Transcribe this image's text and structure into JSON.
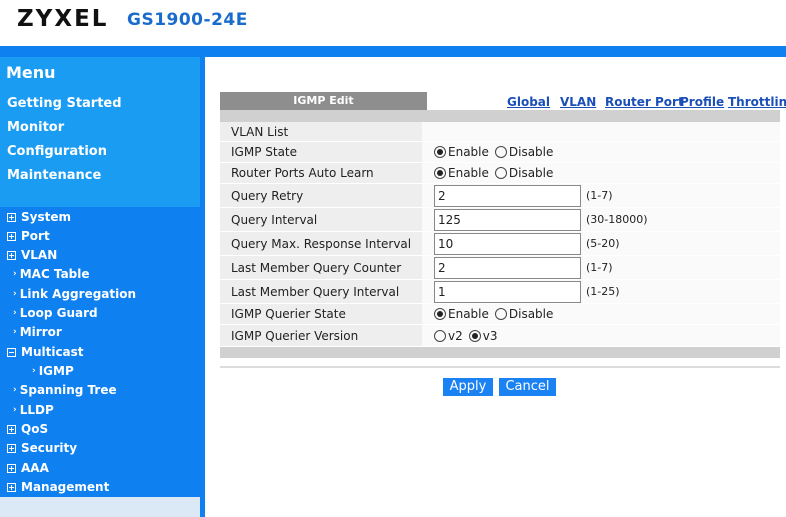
{
  "header": {
    "brand": "ZYXEL",
    "model": "GS1900-24E"
  },
  "colors": {
    "header_bar": "#0e80f0",
    "sidebar_top": "#1a9cf3",
    "sidebar_bottom": "#0e80f0",
    "link": "#1a4fb8",
    "button": "#1a82f2",
    "model_text": "#1a6ccc"
  },
  "menu": {
    "title": "Menu",
    "items": [
      {
        "label": "Getting Started"
      },
      {
        "label": "Monitor"
      },
      {
        "label": "Configuration"
      },
      {
        "label": "Maintenance"
      }
    ]
  },
  "tree": {
    "items": [
      {
        "label": "System",
        "icon": "plus-box-icon"
      },
      {
        "label": "Port",
        "icon": "plus-box-icon"
      },
      {
        "label": "VLAN",
        "icon": "plus-box-icon"
      },
      {
        "label": "MAC Table",
        "icon": "arrow-icon"
      },
      {
        "label": "Link Aggregation",
        "icon": "arrow-icon"
      },
      {
        "label": "Loop Guard",
        "icon": "arrow-icon"
      },
      {
        "label": "Mirror",
        "icon": "arrow-icon"
      },
      {
        "label": "Multicast",
        "icon": "minus-box-icon"
      },
      {
        "label": "IGMP",
        "icon": "arrow-icon"
      },
      {
        "label": "Spanning Tree",
        "icon": "arrow-icon"
      },
      {
        "label": "LLDP",
        "icon": "arrow-icon"
      },
      {
        "label": "QoS",
        "icon": "plus-box-icon"
      },
      {
        "label": "Security",
        "icon": "plus-box-icon"
      },
      {
        "label": "AAA",
        "icon": "plus-box-icon"
      },
      {
        "label": "Management",
        "icon": "plus-box-icon"
      }
    ]
  },
  "content": {
    "tab_title": "IGMP Edit",
    "links": [
      "Global",
      "VLAN",
      "Router Port",
      "Profile",
      "Throttling"
    ],
    "rows": [
      {
        "label": "VLAN List",
        "type": "empty"
      },
      {
        "label": "IGMP State",
        "type": "radio",
        "options": [
          "Enable",
          "Disable"
        ],
        "selected": "Enable"
      },
      {
        "label": "Router Ports Auto Learn",
        "type": "radio",
        "options": [
          "Enable",
          "Disable"
        ],
        "selected": "Enable"
      },
      {
        "label": "Query Retry",
        "type": "input",
        "value": "2",
        "range": "(1-7)"
      },
      {
        "label": "Query Interval",
        "type": "input",
        "value": "125",
        "range": "(30-18000)"
      },
      {
        "label": "Query Max. Response Interval",
        "type": "input",
        "value": "10",
        "range": "(5-20)"
      },
      {
        "label": "Last Member Query Counter",
        "type": "input",
        "value": "2",
        "range": "(1-7)"
      },
      {
        "label": "Last Member Query Interval",
        "type": "input",
        "value": "1",
        "range": "(1-25)"
      },
      {
        "label": "IGMP Querier State",
        "type": "radio",
        "options": [
          "Enable",
          "Disable"
        ],
        "selected": "Enable"
      },
      {
        "label": "IGMP Querier Version",
        "type": "radio",
        "options": [
          "v2",
          "v3"
        ],
        "selected": "v3"
      }
    ],
    "buttons": {
      "apply": "Apply",
      "cancel": "Cancel"
    }
  }
}
